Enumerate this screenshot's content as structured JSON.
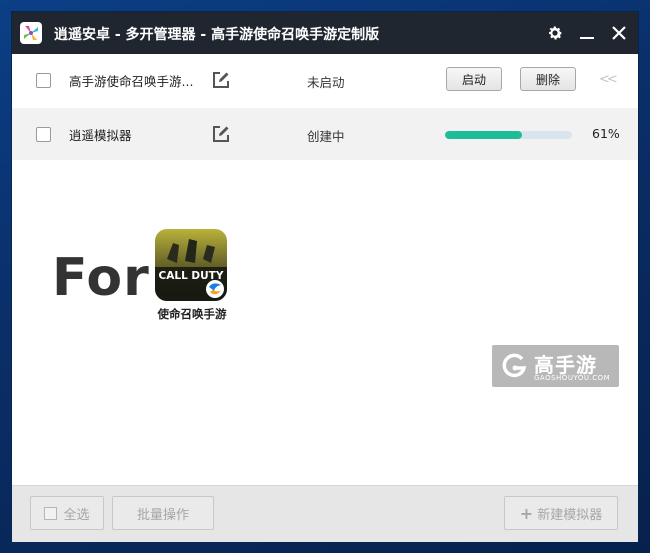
{
  "window": {
    "title": "逍遥安卓 - 多开管理器 - 高手游使命召唤手游定制版"
  },
  "rows": [
    {
      "name": "高手游使命召唤手游...",
      "status": "未启动",
      "start_label": "启动",
      "delete_label": "删除",
      "collapse_glyph": "<<"
    },
    {
      "name": "逍遥模拟器",
      "status": "创建中",
      "progress_percent": 61,
      "progress_text": "61%"
    }
  ],
  "promo": {
    "for_text": "For",
    "game_name": "使命召唤手游",
    "icon_text": "CALL DUTY"
  },
  "watermark": {
    "main": "高手游",
    "sub": "GAOSHOUYOU.COM"
  },
  "footer": {
    "select_all": "全选",
    "batch": "批量操作",
    "new_emulator": "新建模拟器",
    "plus": "+"
  },
  "colors": {
    "titlebar": "#1f2630",
    "progress": "#1ebc97",
    "track": "#d9e4ee"
  },
  "icons": [
    "app-logo-icon",
    "gear-icon",
    "minimize-icon",
    "close-icon",
    "edit-icon",
    "chevron-double-left-icon",
    "plus-icon"
  ]
}
